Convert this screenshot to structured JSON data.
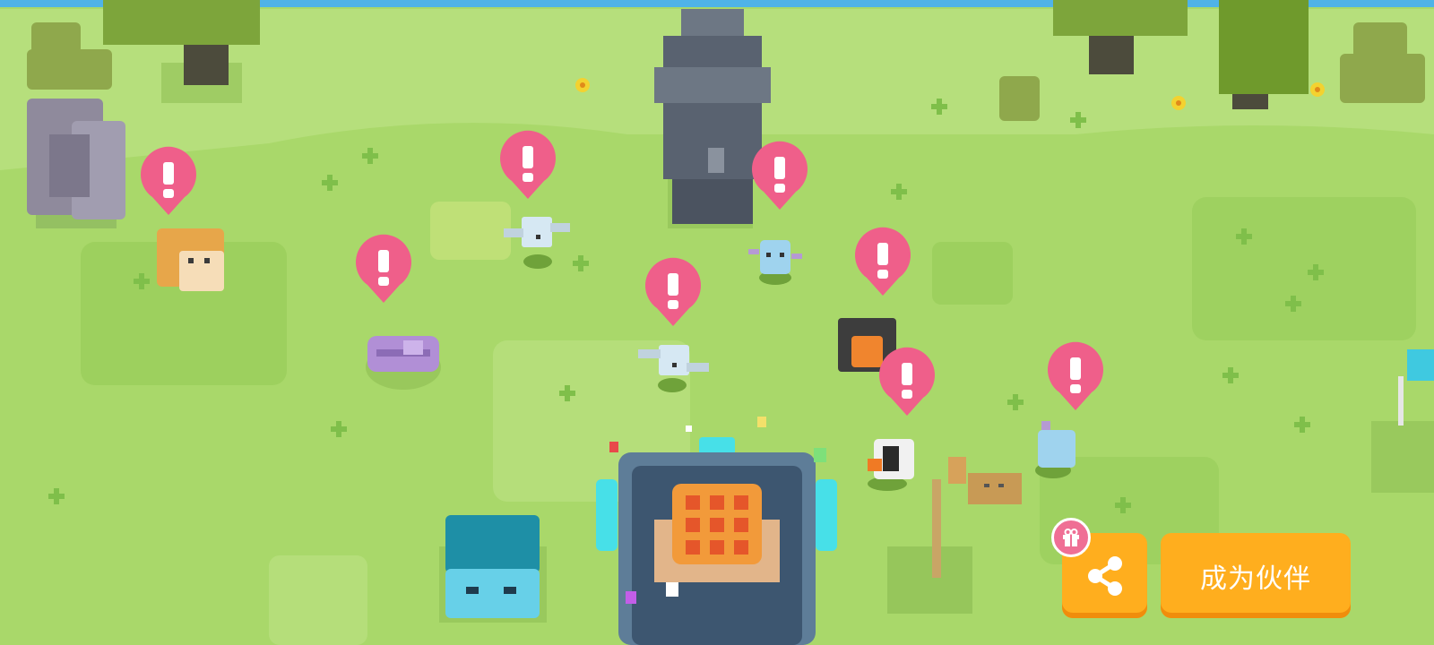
{
  "buttons": {
    "partner_label": "成为伙伴"
  },
  "icons": {
    "share": "share-icon",
    "gift": "gift-icon",
    "alert": "exclamation-icon"
  },
  "colors": {
    "grass": "#a9d86a",
    "alert_pink": "#ef5f8a",
    "button_orange": "#ffae1e",
    "water": "#4fb3e8"
  }
}
